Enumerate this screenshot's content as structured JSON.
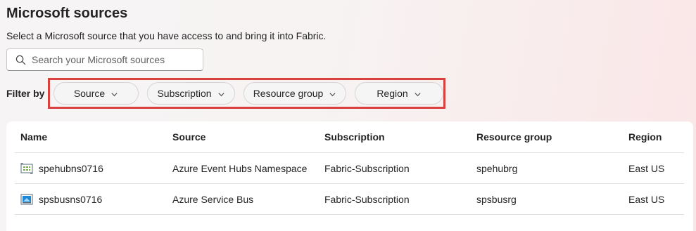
{
  "header": {
    "title": "Microsoft sources",
    "subtitle": "Select a Microsoft source that you have access to and bring it into Fabric."
  },
  "search": {
    "placeholder": "Search your Microsoft sources",
    "icon": "search-icon"
  },
  "filters": {
    "label": "Filter by",
    "items": [
      {
        "label": "Source"
      },
      {
        "label": "Subscription"
      },
      {
        "label": "Resource group"
      },
      {
        "label": "Region"
      }
    ]
  },
  "table": {
    "columns": [
      "Name",
      "Source",
      "Subscription",
      "Resource group",
      "Region"
    ],
    "rows": [
      {
        "icon": "event-hubs-icon",
        "name": "spehubns0716",
        "source": "Azure Event Hubs Namespace",
        "subscription": "Fabric-Subscription",
        "resource_group": "spehubrg",
        "region": "East US"
      },
      {
        "icon": "service-bus-icon",
        "name": "spsbusns0716",
        "source": "Azure Service Bus",
        "subscription": "Fabric-Subscription",
        "resource_group": "spsbusrg",
        "region": "East US"
      }
    ]
  },
  "colors": {
    "highlight": "#d9413f",
    "text": "#242424"
  }
}
